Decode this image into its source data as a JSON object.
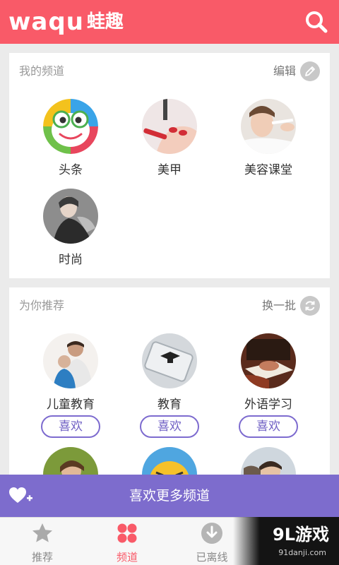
{
  "header": {
    "logo_latin": "waqu",
    "logo_cn": "蛙趣",
    "search_icon": "search-icon",
    "background_color": "#f95a68"
  },
  "my_channels": {
    "title": "我的频道",
    "action_label": "编辑",
    "action_icon": "pencil-icon",
    "items": [
      {
        "name": "头条"
      },
      {
        "name": "美甲"
      },
      {
        "name": "美容课堂"
      },
      {
        "name": "时尚"
      }
    ]
  },
  "recommend": {
    "title": "为你推荐",
    "action_label": "换一批",
    "action_icon": "refresh-icon",
    "items": [
      {
        "name": "儿童教育",
        "like_label": "喜欢"
      },
      {
        "name": "教育",
        "like_label": "喜欢"
      },
      {
        "name": "外语学习",
        "like_label": "喜欢"
      }
    ]
  },
  "more_bar": {
    "label": "喜欢更多频道",
    "icon": "heart-plus-icon",
    "background_color": "#7d6ccd"
  },
  "bottom_nav": {
    "items": [
      {
        "label": "推荐",
        "icon": "star-icon",
        "active": false
      },
      {
        "label": "频道",
        "icon": "grid-dots-icon",
        "active": true
      },
      {
        "label": "已离线",
        "icon": "download-icon",
        "active": false
      }
    ],
    "active_color": "#f95a68"
  },
  "watermark": {
    "main": "9L游戏",
    "sub": "91danji.com"
  }
}
